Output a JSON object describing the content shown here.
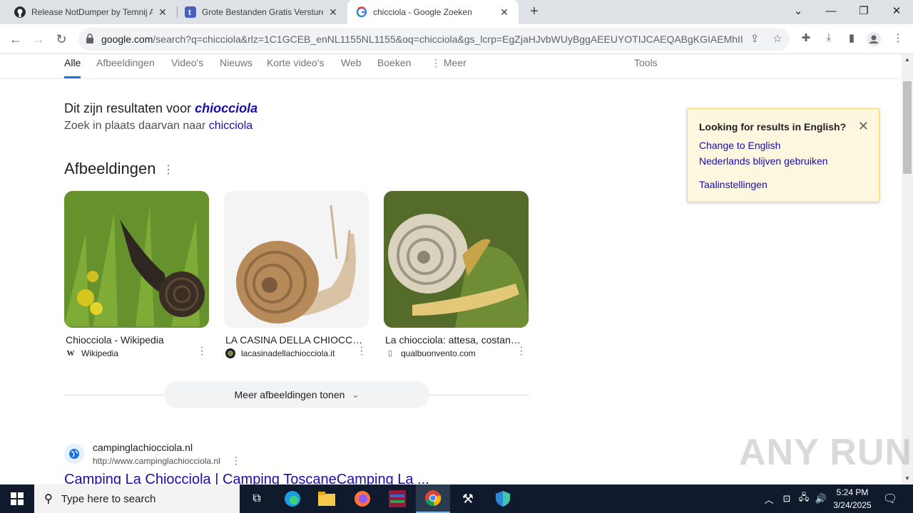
{
  "browser": {
    "tabs": [
      {
        "title": "Release NotDumper by Temnij A",
        "icon": "github-icon"
      },
      {
        "title": "Grote Bestanden Gratis Versturen",
        "icon": "transfer-icon"
      },
      {
        "title": "chicciola - Google Zoeken",
        "icon": "google-icon"
      }
    ],
    "url_host": "google.com",
    "url_rest": "/search?q=chicciola&rlz=1C1GCEB_enNL1155NL1155&oq=chicciola&gs_lcrp=EgZjaHJvbWUyBggAEEUYOTIJCAEQABgKGIAEMhIIAh..."
  },
  "gnav": {
    "items": [
      "Alle",
      "Afbeeldingen",
      "Video's",
      "Nieuws",
      "Korte video's",
      "Web",
      "Boeken",
      "Meer"
    ],
    "tools": "Tools"
  },
  "correction": {
    "prefix": "Dit zijn resultaten voor",
    "corrected": "chiocciola",
    "instead_prefix": "Zoek in plaats daarvan naar",
    "original": "chicciola"
  },
  "images": {
    "heading": "Afbeeldingen",
    "cards": [
      {
        "caption": "Chiocciola - Wikipedia",
        "source": "Wikipedia"
      },
      {
        "caption": "LA CASINA DELLA CHIOCCIOLA",
        "source": "lacasinadellachiocciola.it"
      },
      {
        "caption": "La chiocciola: attesa, costanza e lentezza",
        "source": "qualbuonvento.com"
      }
    ],
    "more": "Meer afbeeldingen tonen"
  },
  "result": {
    "site": "campinglachiocciola.nl",
    "url": "http://www.campinglachiocciola.nl",
    "title": "Camping La Chiocciola | Camping ToscaneCamping La ..."
  },
  "popup": {
    "heading": "Looking for results in English?",
    "change": "Change to English",
    "stay": "Nederlands blijven gebruiken",
    "settings": "Taalinstellingen"
  },
  "watermark": "ANY RUN",
  "taskbar": {
    "search_placeholder": "Type here to search",
    "time": "5:24 PM",
    "date": "3/24/2025"
  }
}
